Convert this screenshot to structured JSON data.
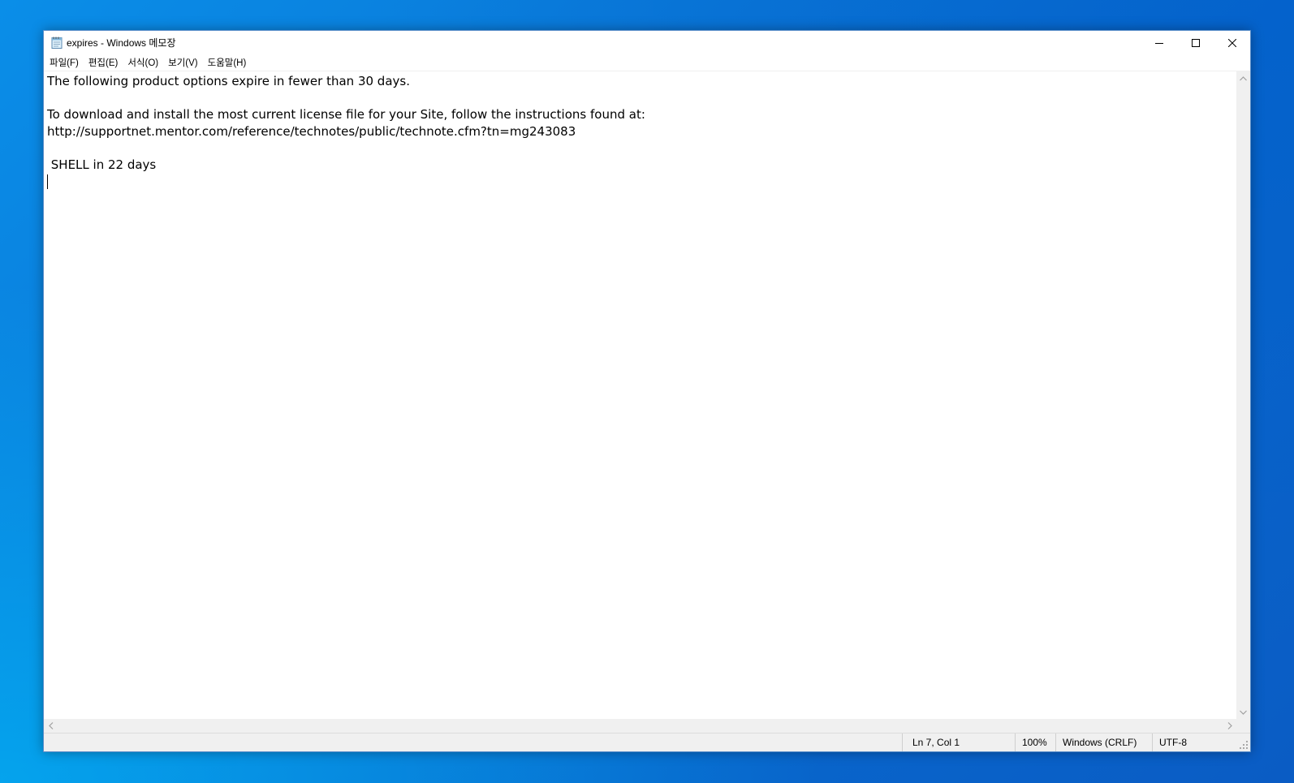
{
  "window": {
    "title": "expires - Windows 메모장",
    "app_icon": "notepad-icon",
    "controls": [
      "minimize-icon",
      "maximize-icon",
      "close-icon"
    ]
  },
  "menu": {
    "items": [
      {
        "label": "파일(F)"
      },
      {
        "label": "편집(E)"
      },
      {
        "label": "서식(O)"
      },
      {
        "label": "보기(V)"
      },
      {
        "label": "도움말(H)"
      }
    ]
  },
  "document": {
    "lines": [
      "The following product options expire in fewer than 30 days.",
      "",
      "To download and install the most current license file for your Site, follow the instructions found at:",
      "http://supportnet.mentor.com/reference/technotes/public/technote.cfm?tn=mg243083",
      "",
      " SHELL in 22 days",
      ""
    ]
  },
  "status": {
    "position": "Ln 7, Col 1",
    "zoom": "100%",
    "line_ending": "Windows (CRLF)",
    "encoding": "UTF-8"
  },
  "colors": {
    "desktop": "#0a78d8",
    "window_border": "#5b8ec9",
    "statusbar": "#f0f0f0"
  }
}
